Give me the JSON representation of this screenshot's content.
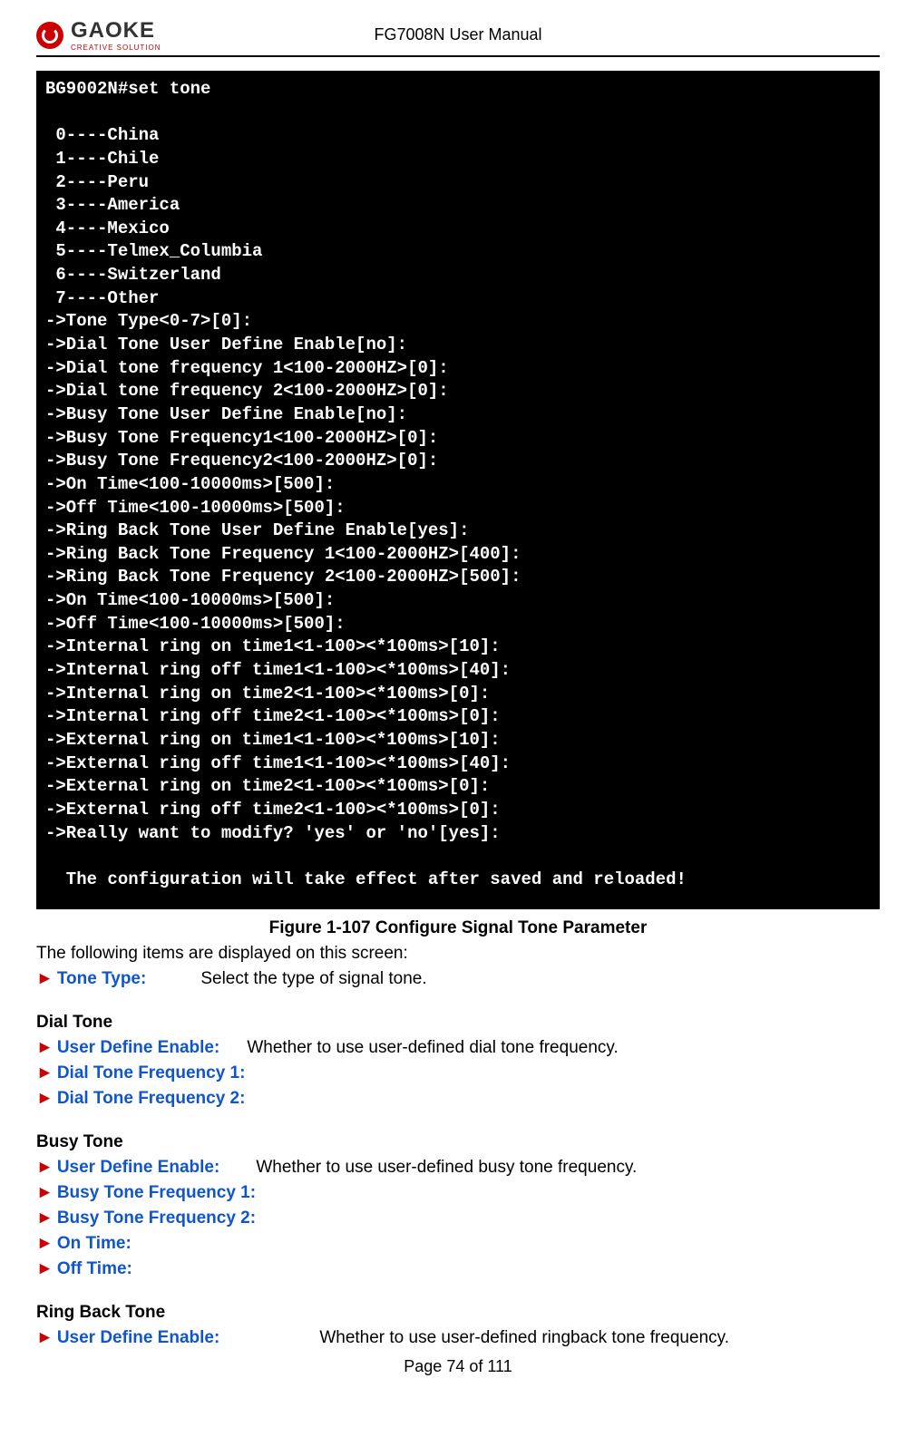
{
  "header": {
    "logo_brand": "GAOKE",
    "logo_tagline": "CREATIVE SOLUTION",
    "title": "FG7008N User Manual"
  },
  "terminal": {
    "lines": [
      "BG9002N#set tone",
      "",
      " 0----China",
      " 1----Chile",
      " 2----Peru",
      " 3----America",
      " 4----Mexico",
      " 5----Telmex_Columbia",
      " 6----Switzerland",
      " 7----Other",
      "->Tone Type<0-7>[0]:",
      "->Dial Tone User Define Enable[no]:",
      "->Dial tone frequency 1<100-2000HZ>[0]:",
      "->Dial tone frequency 2<100-2000HZ>[0]:",
      "->Busy Tone User Define Enable[no]:",
      "->Busy Tone Frequency1<100-2000HZ>[0]:",
      "->Busy Tone Frequency2<100-2000HZ>[0]:",
      "->On Time<100-10000ms>[500]:",
      "->Off Time<100-10000ms>[500]:",
      "->Ring Back Tone User Define Enable[yes]:",
      "->Ring Back Tone Frequency 1<100-2000HZ>[400]:",
      "->Ring Back Tone Frequency 2<100-2000HZ>[500]:",
      "->On Time<100-10000ms>[500]:",
      "->Off Time<100-10000ms>[500]:",
      "->Internal ring on time1<1-100><*100ms>[10]:",
      "->Internal ring off time1<1-100><*100ms>[40]:",
      "->Internal ring on time2<1-100><*100ms>[0]:",
      "->Internal ring off time2<1-100><*100ms>[0]:",
      "->External ring on time1<1-100><*100ms>[10]:",
      "->External ring off time1<1-100><*100ms>[40]:",
      "->External ring on time2<1-100><*100ms>[0]:",
      "->External ring off time2<1-100><*100ms>[0]:",
      "->Really want to modify? 'yes' or 'no'[yes]:",
      "",
      "  The configuration will take effect after saved and reloaded!"
    ]
  },
  "figure_caption": "Figure 1-107  Configure Signal Tone Parameter",
  "intro": "The following items are displayed on this screen:",
  "tone_type": {
    "label": "Tone Type:",
    "desc": "Select the type of signal tone."
  },
  "dial_tone": {
    "heading": "Dial Tone",
    "ude": {
      "label": "User Define Enable:",
      "desc": "Whether to use user-defined dial tone frequency."
    },
    "f1": {
      "label": "Dial Tone Frequency 1:"
    },
    "f2": {
      "label": "Dial Tone Frequency 2:"
    }
  },
  "busy_tone": {
    "heading": "Busy Tone",
    "ude": {
      "label": "User Define Enable:",
      "desc": "Whether to use user-defined busy tone frequency."
    },
    "f1": {
      "label": "Busy Tone Frequency 1:"
    },
    "f2": {
      "label": "Busy Tone Frequency 2:"
    },
    "on": {
      "label": "On Time:"
    },
    "off": {
      "label": "Off Time:"
    }
  },
  "ringback_tone": {
    "heading": "Ring Back Tone",
    "ude": {
      "label": "User Define Enable:",
      "desc": "Whether to use user-defined ringback tone frequency."
    }
  },
  "arrow": "►",
  "footer": "Page 74 of 111"
}
